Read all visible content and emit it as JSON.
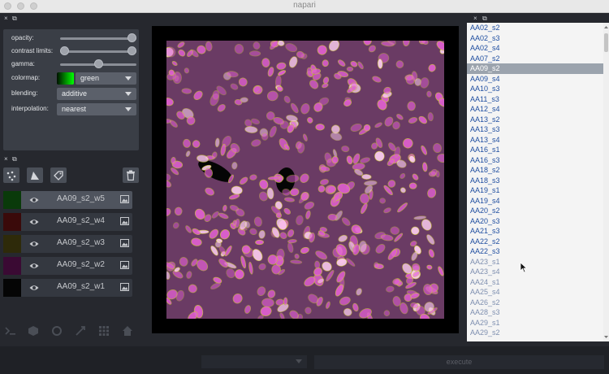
{
  "window": {
    "title": "napari"
  },
  "dock": {
    "close": "×",
    "float": "⧉"
  },
  "layer_controls": {
    "opacity": {
      "label": "opacity:",
      "value": 1.0
    },
    "contrast_limits": {
      "label": "contrast limits:",
      "low": 0.0,
      "high": 1.0
    },
    "gamma": {
      "label": "gamma:",
      "value": 0.5
    },
    "colormap": {
      "label": "colormap:",
      "value": "green"
    },
    "blending": {
      "label": "blending:",
      "value": "additive"
    },
    "interpolation": {
      "label": "interpolation:",
      "value": "nearest"
    }
  },
  "layers": [
    {
      "name": "AA09_s2_w5",
      "selected": true,
      "thumb_color": "#0a3a0a"
    },
    {
      "name": "AA09_s2_w4",
      "selected": false,
      "thumb_color": "#3a0a0a"
    },
    {
      "name": "AA09_s2_w3",
      "selected": false,
      "thumb_color": "#2e2a0a"
    },
    {
      "name": "AA09_s2_w2",
      "selected": false,
      "thumb_color": "#3a0a33"
    },
    {
      "name": "AA09_s2_w1",
      "selected": false,
      "thumb_color": "#050505"
    }
  ],
  "bottom": {
    "execute_label": "execute"
  },
  "file_list": {
    "items": [
      "AA02_s2",
      "AA02_s3",
      "AA02_s4",
      "AA07_s2",
      "AA09_s2",
      "AA09_s4",
      "AA10_s3",
      "AA11_s3",
      "AA12_s4",
      "AA13_s2",
      "AA13_s3",
      "AA13_s4",
      "AA16_s1",
      "AA16_s3",
      "AA18_s2",
      "AA18_s3",
      "AA19_s1",
      "AA19_s4",
      "AA20_s2",
      "AA20_s3",
      "AA21_s3",
      "AA22_s2",
      "AA22_s3",
      "AA23_s1",
      "AA23_s4",
      "AA24_s1",
      "AA25_s4",
      "AA26_s2",
      "AA28_s3",
      "AA29_s1",
      "AA29_s2"
    ],
    "selected": "AA09_s2"
  },
  "colors": {
    "background": "#262930",
    "panel": "#3a3e46",
    "list_text": "#1f4ea0",
    "cell_magenta": "#e060d0",
    "cell_yellow": "#c8c830"
  }
}
